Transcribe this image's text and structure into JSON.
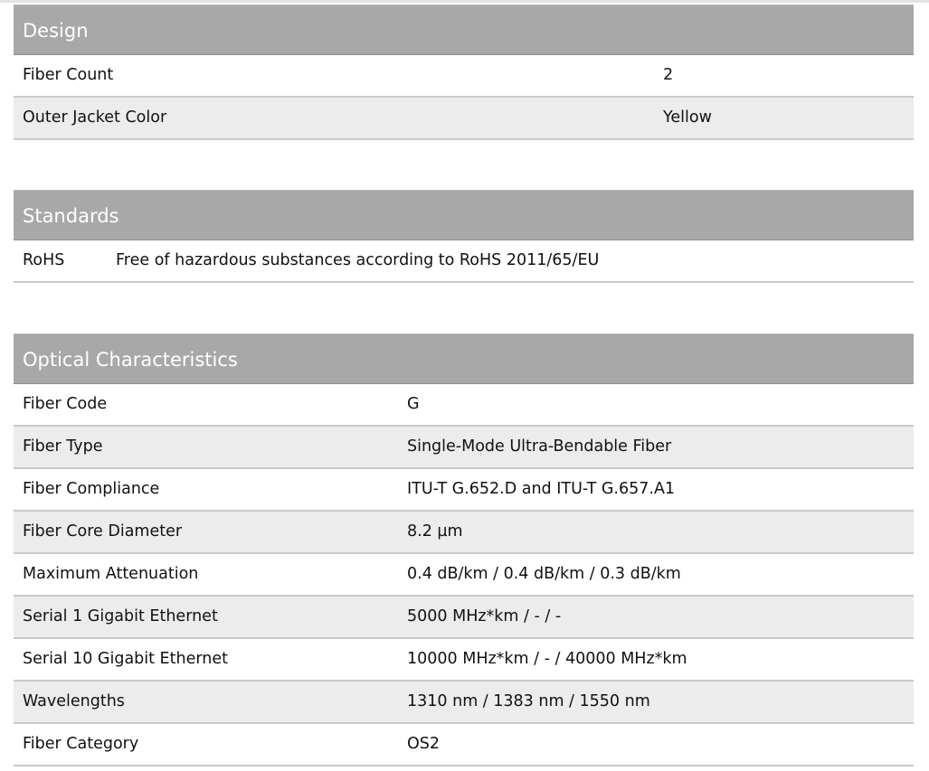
{
  "design": {
    "title": "Design",
    "rows": [
      {
        "label": "Fiber Count",
        "value": "2"
      },
      {
        "label": "Outer Jacket Color",
        "value": "Yellow"
      }
    ]
  },
  "standards": {
    "title": "Standards",
    "rows": [
      {
        "label": "RoHS",
        "value": "Free of hazardous substances according to RoHS 2011/65/EU"
      }
    ]
  },
  "optical": {
    "title": "Optical Characteristics",
    "rows": [
      {
        "label": "Fiber Code",
        "value": "G"
      },
      {
        "label": "Fiber Type",
        "value": "Single-Mode Ultra-Bendable Fiber"
      },
      {
        "label": "Fiber Compliance",
        "value": "ITU-T G.652.D and ITU-T G.657.A1"
      },
      {
        "label": "Fiber Core Diameter",
        "value": "8.2 µm"
      },
      {
        "label": "Maximum Attenuation",
        "value": "0.4 dB/km / 0.4 dB/km / 0.3 dB/km"
      },
      {
        "label": "Serial 1 Gigabit Ethernet",
        "value": "5000 MHz*km / - / -"
      },
      {
        "label": "Serial 10 Gigabit Ethernet",
        "value": "10000 MHz*km / - / 40000 MHz*km"
      },
      {
        "label": "Wavelengths",
        "value": "1310 nm / 1383 nm / 1550 nm"
      },
      {
        "label": "Fiber Category",
        "value": "OS2"
      }
    ]
  }
}
